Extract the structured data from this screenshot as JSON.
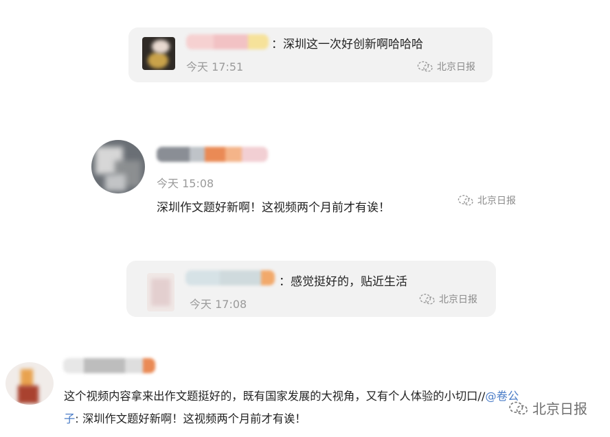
{
  "watermark": "北京日报",
  "comments": [
    {
      "text": "：深圳这一次好创新啊哈哈哈",
      "time": "今天 17:51"
    },
    {
      "time": "今天 15:08",
      "text": "深圳作文题好新啊！这视频两个月前才有诶！"
    },
    {
      "text": "：感觉挺好的，贴近生活",
      "time": "今天 17:08"
    },
    {
      "text_line1": "这个视频内容拿来出作文题挺好的，既有国家发展的大视角，又有个人体验的小切口//",
      "mention": "@卷公子",
      "mention_line1": "@卷公",
      "mention_line2": "子",
      "text_line2": ": 深圳作文题好新啊！这视频两个月前才有诶！"
    }
  ]
}
